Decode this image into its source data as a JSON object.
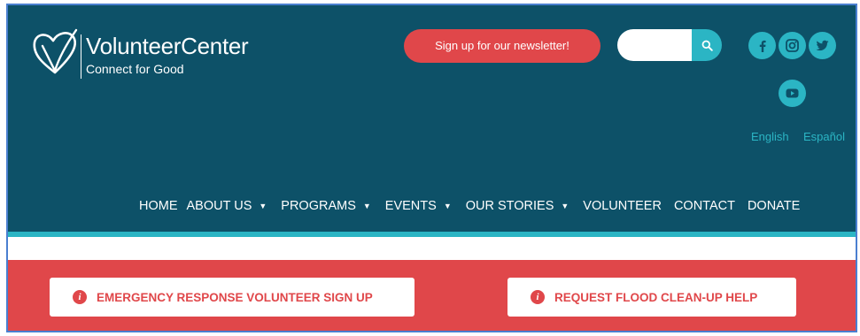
{
  "brand": {
    "name": "VolunteerCenter",
    "tagline": "Connect for Good"
  },
  "header": {
    "newsletter_label": "Sign up for our newsletter!",
    "search": {
      "value": "",
      "placeholder": ""
    },
    "social": [
      "facebook-icon",
      "instagram-icon",
      "twitter-icon",
      "youtube-icon"
    ],
    "languages": [
      "English",
      "Español"
    ]
  },
  "nav": {
    "items": [
      {
        "label": "HOME",
        "dropdown": false
      },
      {
        "label": "ABOUT US",
        "dropdown": true
      },
      {
        "label": "PROGRAMS",
        "dropdown": true
      },
      {
        "label": "EVENTS",
        "dropdown": true
      },
      {
        "label": "OUR STORIES",
        "dropdown": true
      },
      {
        "label": "VOLUNTEER",
        "dropdown": false
      },
      {
        "label": "CONTACT",
        "dropdown": false
      },
      {
        "label": "DONATE",
        "dropdown": false
      }
    ]
  },
  "actions": [
    {
      "label": "EMERGENCY RESPONSE VOLUNTEER SIGN UP",
      "icon": "info-icon"
    },
    {
      "label": "REQUEST FLOOD CLEAN-UP HELP",
      "icon": "info-icon"
    }
  ],
  "colors": {
    "header_bg": "#0d5168",
    "accent_teal": "#2bb5c4",
    "accent_red": "#e0474a"
  }
}
